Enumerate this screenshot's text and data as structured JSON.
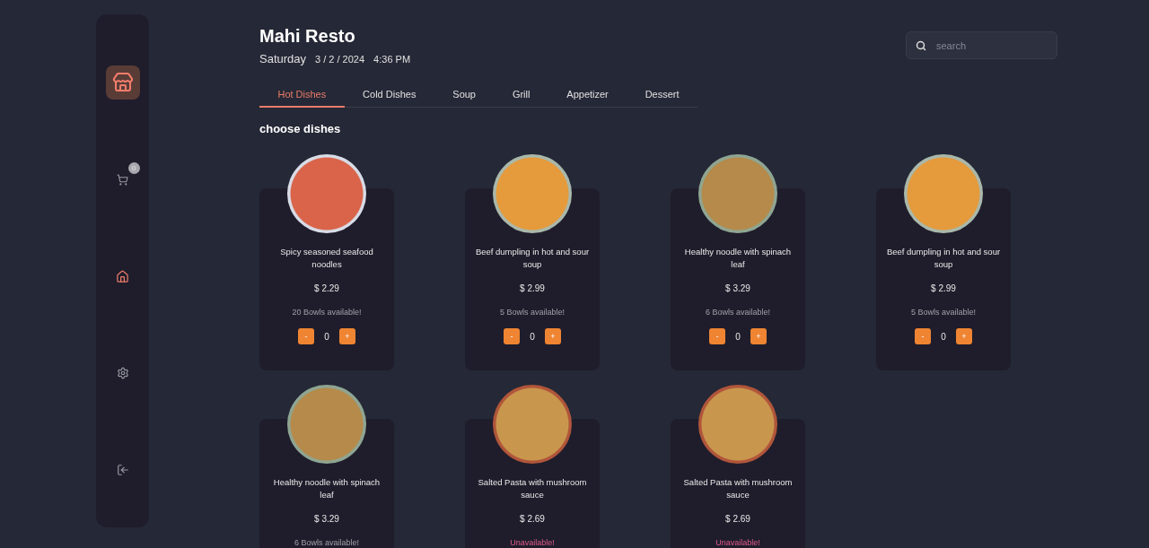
{
  "sidebar": {
    "items": [
      {
        "kind": "cart",
        "selected": false,
        "badge": "0"
      },
      {
        "kind": "home",
        "selected": true
      },
      {
        "kind": "settings",
        "selected": false
      },
      {
        "kind": "logout",
        "selected": false
      }
    ]
  },
  "header": {
    "title": "Mahi Resto",
    "day": "Saturday",
    "date": "3 / 2 / 2024",
    "time": "4:36 PM"
  },
  "search": {
    "placeholder": "search"
  },
  "tabs": [
    {
      "label": "Hot Dishes",
      "selected": true
    },
    {
      "label": "Cold Dishes",
      "selected": false
    },
    {
      "label": "Soup",
      "selected": false
    },
    {
      "label": "Grill",
      "selected": false
    },
    {
      "label": "Appetizer",
      "selected": false
    },
    {
      "label": "Dessert",
      "selected": false
    }
  ],
  "section_title": "choose dishes",
  "dishes": [
    {
      "name": "Spicy seasoned seafood noodles",
      "price": "$ 2.29",
      "availability": "20 Bowls available!",
      "available": true,
      "minus": "-",
      "quantity": "0",
      "plus": "+"
    },
    {
      "name": "Beef dumpling in hot and sour soup",
      "price": "$ 2.99",
      "availability": "5 Bowls available!",
      "available": true,
      "minus": "-",
      "quantity": "0",
      "plus": "+"
    },
    {
      "name": "Healthy noodle with spinach leaf",
      "price": "$ 3.29",
      "availability": "6 Bowls available!",
      "available": true,
      "minus": "-",
      "quantity": "0",
      "plus": "+"
    },
    {
      "name": "Beef dumpling in hot and sour soup",
      "price": "$ 2.99",
      "availability": "5 Bowls available!",
      "available": true,
      "minus": "-",
      "quantity": "0",
      "plus": "+"
    },
    {
      "name": "Healthy noodle with spinach leaf",
      "price": "$ 3.29",
      "availability": "6 Bowls available!",
      "available": true
    },
    {
      "name": "Salted Pasta with mushroom sauce",
      "price": "$ 2.69",
      "availability": "Unavailable!",
      "available": false
    },
    {
      "name": "Salted Pasta with mushroom sauce",
      "price": "$ 2.69",
      "availability": "Unavailable!",
      "available": false
    }
  ]
}
